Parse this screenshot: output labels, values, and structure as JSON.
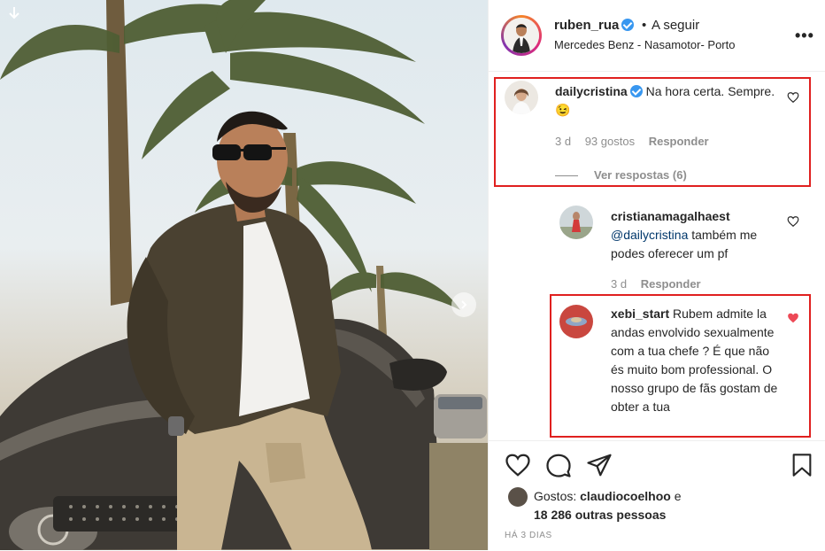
{
  "header": {
    "username": "ruben_rua",
    "separator": "•",
    "follow_label": "A seguir",
    "location": "Mercedes Benz - Nasamotor- Porto",
    "more_label": "•••"
  },
  "comments": [
    {
      "username": "dailycristina",
      "text": "Na hora certa. Sempre. 😉",
      "time": "3 d",
      "likes": "93 gostos",
      "reply_label": "Responder",
      "view_replies": "Ver respostas (6)"
    },
    {
      "username": "cristianamagalhaest",
      "mention": "@dailycristina",
      "text": "também me podes oferecer um pf",
      "time": "3 d",
      "reply_label": "Responder"
    },
    {
      "username": "xebi_start",
      "text": "Rubem admite la andas envolvido sexualmente com a tua chefe ? É que não és muito bom professional. O nosso grupo de fãs gostam de obter a tua"
    }
  ],
  "likes": {
    "prefix": "Gostos:",
    "user": "claudiocoelhoo",
    "conj": "e",
    "others": "18 286 outras pessoas"
  },
  "timestamp": "HÁ 3 DIAS",
  "colors": {
    "verified": "#3897f0",
    "liked_heart": "#ed4956",
    "highlight_box": "#e0201f",
    "mention": "#00376b",
    "muted_text": "#8e8e8e"
  },
  "icons": [
    "download-icon",
    "chevron-right-icon",
    "verified-icon",
    "more-icon",
    "heart-icon",
    "comment-icon",
    "share-icon",
    "bookmark-icon"
  ]
}
